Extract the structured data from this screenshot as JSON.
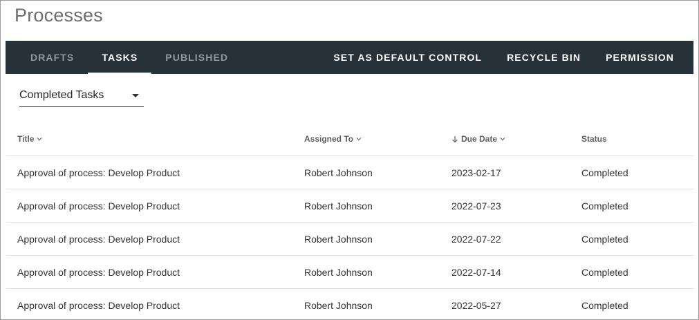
{
  "page": {
    "title": "Processes"
  },
  "tabs": [
    {
      "label": "DRAFTS",
      "active": false
    },
    {
      "label": "TASKS",
      "active": true
    },
    {
      "label": "PUBLISHED",
      "active": false
    }
  ],
  "actions": [
    {
      "label": "SET AS DEFAULT CONTROL"
    },
    {
      "label": "RECYCLE BIN"
    },
    {
      "label": "PERMISSION"
    }
  ],
  "filter": {
    "selected": "Completed Tasks"
  },
  "table": {
    "columns": [
      {
        "label": "Title",
        "sortable": true,
        "sorted": false
      },
      {
        "label": "Assigned To",
        "sortable": true,
        "sorted": false
      },
      {
        "label": "Due Date",
        "sortable": true,
        "sorted": true,
        "direction": "desc"
      },
      {
        "label": "Status",
        "sortable": false,
        "sorted": false
      }
    ],
    "rows": [
      {
        "title": "Approval of process: Develop Product",
        "assigned": "Robert Johnson",
        "due": "2023-02-17",
        "status": "Completed"
      },
      {
        "title": "Approval of process: Develop Product",
        "assigned": "Robert Johnson",
        "due": "2022-07-23",
        "status": "Completed"
      },
      {
        "title": "Approval of process: Develop Product",
        "assigned": "Robert Johnson",
        "due": "2022-07-22",
        "status": "Completed"
      },
      {
        "title": "Approval of process: Develop Product",
        "assigned": "Robert Johnson",
        "due": "2022-07-14",
        "status": "Completed"
      },
      {
        "title": "Approval of process: Develop Product",
        "assigned": "Robert Johnson",
        "due": "2022-05-27",
        "status": "Completed"
      }
    ]
  },
  "theme": {
    "navbar_bg": "#263238",
    "active_tab": "#ffffff",
    "inactive_tab": "#8f9a9f",
    "title_color": "#6d6d6d",
    "row_divider": "#e0e0e0"
  },
  "icons": {
    "dropdown": "caret-down-icon",
    "column_sort": "chevron-down-icon",
    "sort_direction": "arrow-down-icon"
  }
}
